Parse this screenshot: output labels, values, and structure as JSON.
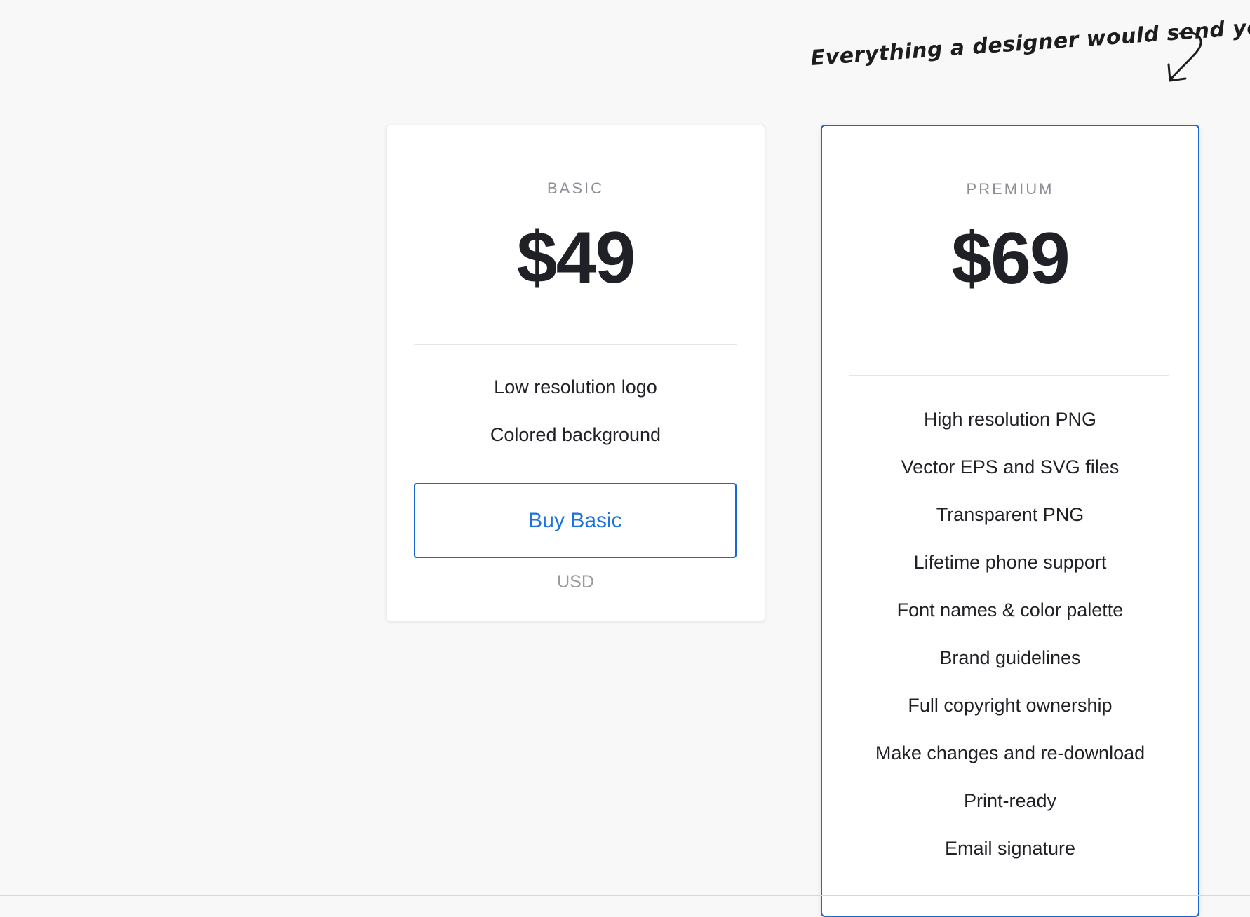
{
  "annotation": {
    "text": "Everything a designer would send you",
    "icon": "curved-arrow-down-icon"
  },
  "plans": {
    "basic": {
      "name": "BASIC",
      "price": "$49",
      "features": [
        "Low resolution logo",
        "Colored background"
      ],
      "button_label": "Buy Basic",
      "currency": "USD"
    },
    "premium": {
      "name": "PREMIUM",
      "price": "$69",
      "features": [
        "High resolution PNG",
        "Vector EPS and SVG files",
        "Transparent PNG",
        "Lifetime phone support",
        "Font names & color palette",
        "Brand guidelines",
        "Full copyright ownership",
        "Make changes and re-download",
        "Print-ready",
        "Email signature"
      ]
    }
  },
  "colors": {
    "accent": "#1a66d2",
    "background": "#f8f8f8",
    "text": "#1f2126",
    "muted": "#8b8f95"
  }
}
